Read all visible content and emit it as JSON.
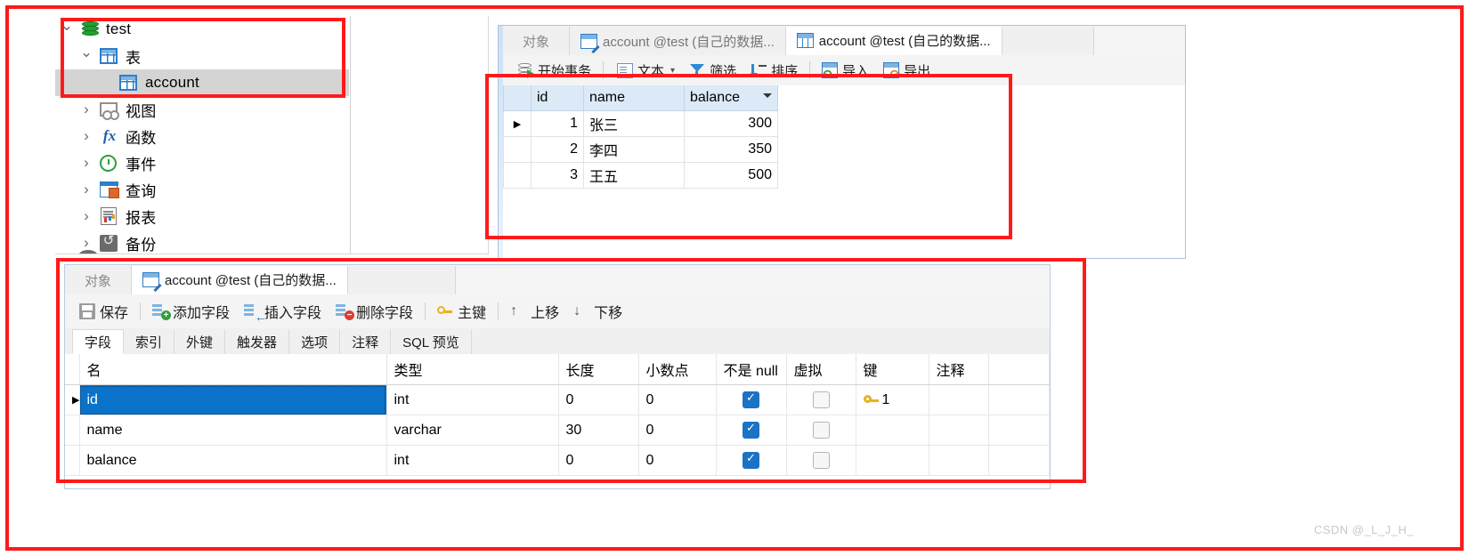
{
  "tree": {
    "items": [
      {
        "label": "test",
        "icon": "database-icon",
        "indent": 0,
        "expander": "open",
        "selected": false
      },
      {
        "label": "表",
        "icon": "table-group-icon",
        "indent": 1,
        "expander": "open",
        "selected": false
      },
      {
        "label": "account",
        "icon": "table-icon",
        "indent": 2,
        "expander": "none",
        "selected": true
      },
      {
        "label": "视图",
        "icon": "view-icon",
        "indent": 1,
        "expander": "closed",
        "selected": false
      },
      {
        "label": "函数",
        "icon": "function-icon",
        "indent": 1,
        "expander": "closed",
        "selected": false
      },
      {
        "label": "事件",
        "icon": "event-clock-icon",
        "indent": 1,
        "expander": "closed",
        "selected": false
      },
      {
        "label": "查询",
        "icon": "query-icon",
        "indent": 1,
        "expander": "closed",
        "selected": false
      },
      {
        "label": "报表",
        "icon": "report-icon",
        "indent": 1,
        "expander": "closed",
        "selected": false
      },
      {
        "label": "备份",
        "icon": "backup-icon",
        "indent": 1,
        "expander": "closed",
        "selected": false
      }
    ]
  },
  "grid_window": {
    "tabs": [
      {
        "label": "对象",
        "icon": "none",
        "active": false
      },
      {
        "label": "account @test (自己的数据...",
        "icon": "design-icon",
        "active": false
      },
      {
        "label": "account @test (自己的数据...",
        "icon": "table-icon",
        "active": true
      }
    ],
    "toolbar": [
      {
        "label": "开始事务",
        "icon": "transaction-icon"
      },
      {
        "label": "文本",
        "icon": "text-doc-icon",
        "caret": "▾"
      },
      {
        "label": "筛选",
        "icon": "filter-icon"
      },
      {
        "label": "排序",
        "icon": "sort-icon"
      },
      {
        "label": "导入",
        "icon": "import-icon"
      },
      {
        "label": "导出",
        "icon": "export-icon"
      }
    ],
    "table": {
      "columns": [
        "id",
        "name",
        "balance"
      ],
      "sorted_column": "balance",
      "rows": [
        {
          "marker": "▶",
          "id": "1",
          "name": "张三",
          "balance": "300"
        },
        {
          "marker": "",
          "id": "2",
          "name": "李四",
          "balance": "350"
        },
        {
          "marker": "",
          "id": "3",
          "name": "王五",
          "balance": "500"
        }
      ]
    }
  },
  "design_window": {
    "tabs": [
      {
        "label": "对象",
        "icon": "none",
        "active": false
      },
      {
        "label": "account @test (自己的数据...",
        "icon": "design-icon",
        "active": true
      }
    ],
    "toolbar": [
      {
        "label": "保存",
        "icon": "save-icon"
      },
      {
        "label": "添加字段",
        "icon": "add-field-icon"
      },
      {
        "label": "插入字段",
        "icon": "insert-field-icon"
      },
      {
        "label": "删除字段",
        "icon": "delete-field-icon"
      },
      {
        "label": "主键",
        "icon": "primary-key-icon"
      },
      {
        "label": "上移",
        "icon": "arrow-up-icon"
      },
      {
        "label": "下移",
        "icon": "arrow-down-icon"
      }
    ],
    "subtabs": [
      "字段",
      "索引",
      "外键",
      "触发器",
      "选项",
      "注释",
      "SQL 预览"
    ],
    "active_subtab": "字段",
    "fields": {
      "columns": [
        "名",
        "类型",
        "长度",
        "小数点",
        "不是 null",
        "虚拟",
        "键",
        "注释"
      ],
      "rows": [
        {
          "marker": "▶",
          "name": "id",
          "type": "int",
          "length": "0",
          "decimals": "0",
          "not_null": true,
          "virtual": false,
          "key": "1",
          "comment": "",
          "selected": true
        },
        {
          "marker": "",
          "name": "name",
          "type": "varchar",
          "length": "30",
          "decimals": "0",
          "not_null": true,
          "virtual": false,
          "key": "",
          "comment": "",
          "selected": false
        },
        {
          "marker": "",
          "name": "balance",
          "type": "int",
          "length": "0",
          "decimals": "0",
          "not_null": true,
          "virtual": false,
          "key": "",
          "comment": "",
          "selected": false
        }
      ]
    }
  },
  "watermark": {
    "text": "CSDN @_L_J_H_"
  },
  "colors": {
    "annotation_red": "#ff1a1a",
    "selection_blue": "#0a72c8",
    "tree_selection_gray": "#d4d4d4",
    "header_blue": "#dceaf7",
    "key_yellow": "#e8b21e",
    "checkbox_blue": "#1a73c4"
  }
}
